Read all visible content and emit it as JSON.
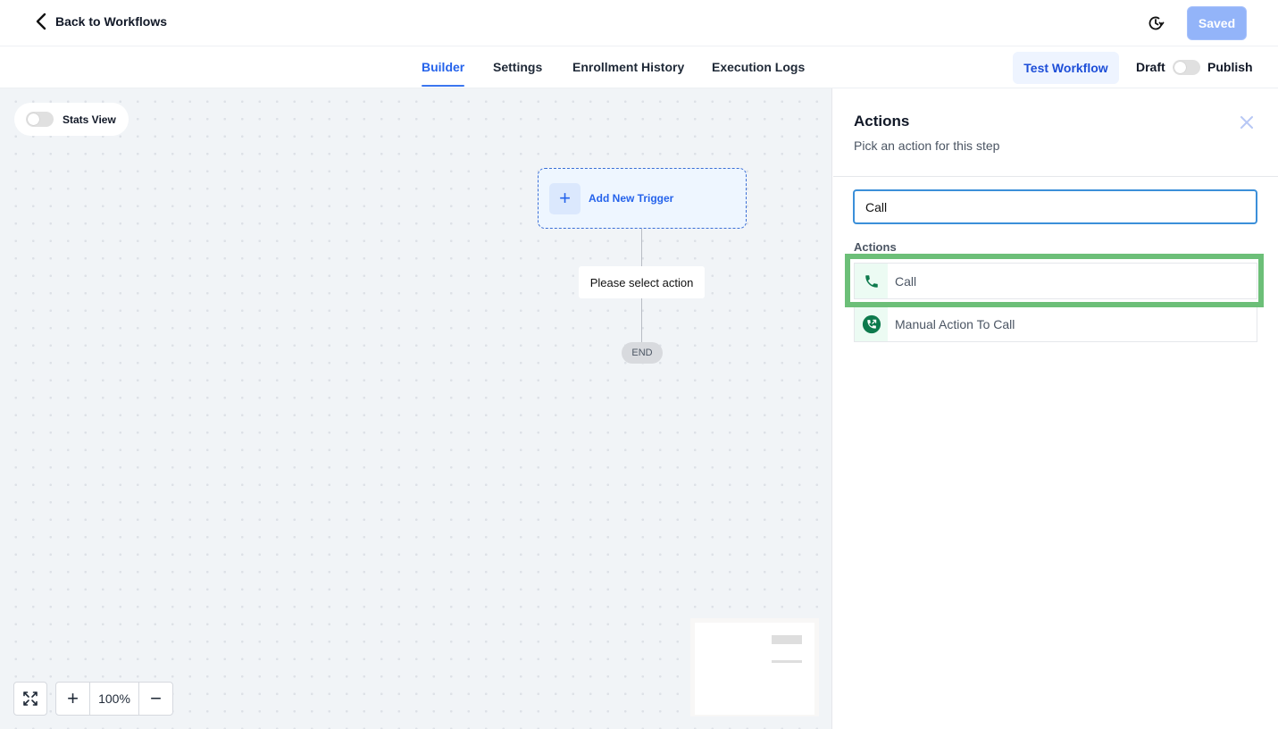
{
  "header": {
    "back_label": "Back to Workflows",
    "saved_label": "Saved"
  },
  "tabs": [
    {
      "label": "Builder",
      "active": true
    },
    {
      "label": "Settings",
      "active": false
    },
    {
      "label": "Enrollment History",
      "active": false
    },
    {
      "label": "Execution Logs",
      "active": false
    }
  ],
  "toolbar": {
    "test_workflow_label": "Test Workflow",
    "draft_label": "Draft",
    "publish_label": "Publish",
    "publish_on": false
  },
  "canvas": {
    "stats_view_label": "Stats View",
    "stats_view_on": false,
    "trigger_label": "Add New Trigger",
    "action_placeholder": "Please select action",
    "end_label": "END",
    "zoom_level": "100%"
  },
  "panel": {
    "title": "Actions",
    "subtitle": "Pick an action for this step",
    "search_value": "Call",
    "section_label": "Actions",
    "items": [
      {
        "label": "Call",
        "icon": "phone-icon",
        "highlighted": true
      },
      {
        "label": "Manual Action To Call",
        "icon": "manual-call-icon",
        "highlighted": false
      }
    ]
  },
  "colors": {
    "accent": "#2563eb",
    "highlight": "#6cbf78",
    "icon_green": "#0e7a4d"
  }
}
